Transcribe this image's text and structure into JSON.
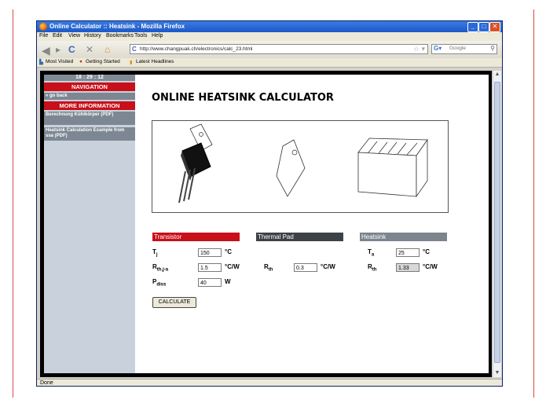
{
  "window": {
    "title": "Online Calculator :: Heatsink - Mozilla Firefox"
  },
  "menu": [
    "File",
    "Edit",
    "View",
    "History",
    "Bookmarks",
    "Tools",
    "Help"
  ],
  "toolbar": {
    "url": "http://www.changpuak.ch/electronics/calc_23.html",
    "search_placeholder": "Google"
  },
  "bookmarks": [
    "Most Visited",
    "Getting Started",
    "Latest Headlines"
  ],
  "sidebar": {
    "clock": "18 : 29 : 12",
    "nav_heading": "NAVIGATION",
    "back": "« go back",
    "more_heading": "MORE INFORMATION",
    "links": [
      "Berechnung Kühlkörper (PDF)",
      "Heatsink Calculation Example from ssa (PDF)"
    ]
  },
  "page": {
    "title": "ONLINE HEATSINK CALCULATOR",
    "sections": {
      "transistor": "Transistor",
      "thermal_pad": "Thermal Pad",
      "heatsink": "Heatsink"
    },
    "labels": {
      "tj_main": "T",
      "tj_sub": "j",
      "rthja_main": "R",
      "rthja_sub": "th,j-a",
      "pdiss_main": "P",
      "pdiss_sub": "diss",
      "rth_pad_main": "R",
      "rth_pad_sub": "th",
      "ta_main": "T",
      "ta_sub": "a",
      "rth_hs_main": "R",
      "rth_hs_sub": "th"
    },
    "values": {
      "tj": "150",
      "rthja": "1.5",
      "pdiss": "40",
      "rth_pad": "0.3",
      "ta": "25",
      "rth_hs": "1.33"
    },
    "units": {
      "tj": "°C",
      "rthja": "°C/W",
      "pdiss": "W",
      "rth_pad": "°C/W",
      "ta": "°C",
      "rth_hs": "°C/W"
    },
    "calculate": "CALCULATE"
  },
  "status": "Done",
  "colors": {
    "accent_red": "#c8101a",
    "section_dark": "#3d4247",
    "section_grey": "#7c858e"
  }
}
